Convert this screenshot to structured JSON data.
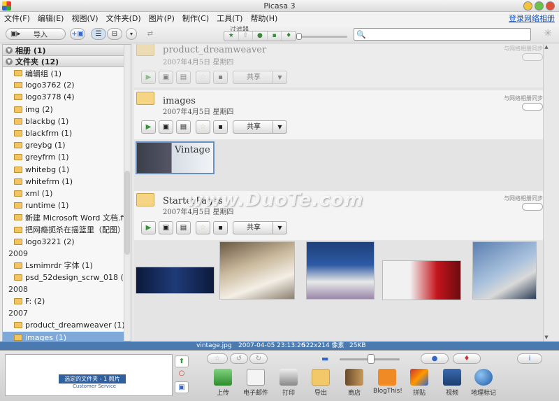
{
  "window": {
    "title": "Picasa 3"
  },
  "menu": {
    "items": [
      "文件(F)",
      "编辑(E)",
      "视图(V)",
      "文件夹(D)",
      "图片(P)",
      "制作(C)",
      "工具(T)",
      "帮助(H)"
    ],
    "login": "登录网络相册"
  },
  "toolbar": {
    "import_label": "导入",
    "filter_label": "过滤器",
    "filter_icons": [
      "star-icon",
      "upload-icon",
      "person-icon",
      "video-icon",
      "geotag-icon"
    ],
    "search_placeholder": ""
  },
  "sidebar": {
    "albums_header": "相册 (1)",
    "folders_header": "文件夹 (12)",
    "folders": [
      "编辑组 (1)",
      "logo3762 (2)",
      "logo3778 (4)",
      "img (2)",
      "blackbg (1)",
      "blackfrm (1)",
      "greybg (1)",
      "greyfrm (1)",
      "whitebg (1)",
      "whitefrm (1)",
      "xml (1)",
      "runtime (1)",
      "新建 Microsoft Word 文档.files...",
      "把网瘾扼杀在摇篮里（配图）...",
      "logo3221 (2)"
    ],
    "year_2009": "2009",
    "folders_2009": [
      "Lsmimrdr 字体 (1)",
      "psd_52design_scrw_018 (1)"
    ],
    "year_2008": "2008",
    "folders_2008": [
      "F: (2)"
    ],
    "year_2007": "2007",
    "folders_2007": [
      "product_dreamweaver (1)",
      "images (1)"
    ]
  },
  "albums": [
    {
      "title": "product_dreamweaver",
      "date": "2007年4月5日 星期四",
      "sync": "与网络相册同步",
      "share": "共享"
    },
    {
      "title": "images",
      "date": "2007年4月5日 星期四",
      "sync": "与网络相册同步",
      "share": "共享"
    },
    {
      "title": "StarterPages",
      "date": "2007年4月5日 星期四",
      "sync": "与网络相册同步",
      "share": "共享"
    }
  ],
  "thumb_text": {
    "vintage": "Vintage"
  },
  "watermark": "www.DuoTe.com",
  "status": {
    "filename": "vintage.jpg",
    "datetime": "2007-04-05 23:13:26",
    "dims": "522x214 像素",
    "size": "25KB"
  },
  "tray": {
    "selection_label": "选定的文件夹 - 1 照片",
    "selection_sub": "Customer Service",
    "tools": [
      "上传",
      "电子邮件",
      "打印",
      "导出",
      "商店",
      "BlogThis!",
      "拼贴",
      "视频",
      "地理标记"
    ]
  }
}
